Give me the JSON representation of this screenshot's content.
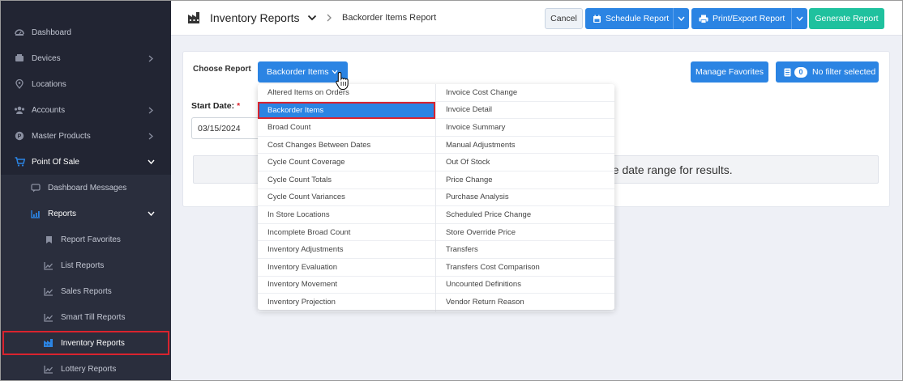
{
  "sidebar": {
    "items": [
      {
        "label": "Dashboard",
        "icon": "dashboard-icon"
      },
      {
        "label": "Devices",
        "icon": "devices-icon"
      },
      {
        "label": "Locations",
        "icon": "location-pin-icon"
      },
      {
        "label": "Accounts",
        "icon": "users-icon"
      },
      {
        "label": "Master Products",
        "icon": "product-icon"
      },
      {
        "label": "Point Of Sale",
        "icon": "cart-icon"
      },
      {
        "label": "Dashboard Messages",
        "icon": "message-icon"
      },
      {
        "label": "Reports",
        "icon": "chart-icon"
      },
      {
        "label": "Report Favorites",
        "icon": "bookmark-icon"
      },
      {
        "label": "List Reports",
        "icon": "chart-icon"
      },
      {
        "label": "Sales Reports",
        "icon": "chart-icon"
      },
      {
        "label": "Smart Till Reports",
        "icon": "chart-icon"
      },
      {
        "label": "Inventory Reports",
        "icon": "factory-icon"
      },
      {
        "label": "Lottery Reports",
        "icon": "chart-icon"
      }
    ]
  },
  "header": {
    "title": "Inventory Reports",
    "breadcrumb": "Backorder Items Report",
    "cancel_label": "Cancel",
    "schedule_label": "Schedule Report",
    "print_label": "Print/Export Report",
    "generate_label": "Generate Report"
  },
  "report": {
    "choose_label": "Choose Report",
    "selected": "Backorder Items",
    "manage_favorites_label": "Manage Favorites",
    "filter_count": "0",
    "filter_label": "No filter selected",
    "start_date_label": "Start Date:",
    "required_mark": "*",
    "start_date_value": "03/15/2024",
    "info_text": "he date range for results."
  },
  "menu": {
    "left": [
      "Altered Items on Orders",
      "Backorder Items",
      "Broad Count",
      "Cost Changes Between Dates",
      "Cycle Count Coverage",
      "Cycle Count Totals",
      "Cycle Count Variances",
      "In Store Locations",
      "Incomplete Broad Count",
      "Inventory Adjustments",
      "Inventory Evaluation",
      "Inventory Movement",
      "Inventory Projection"
    ],
    "right": [
      "Invoice Cost Change",
      "Invoice Detail",
      "Invoice Summary",
      "Manual Adjustments",
      "Out Of Stock",
      "Price Change",
      "Purchase Analysis",
      "Scheduled Price Change",
      "Store Override Price",
      "Transfers",
      "Transfers Cost Comparison",
      "Uncounted Definitions",
      "Vendor Return Reason"
    ]
  },
  "colors": {
    "sidebar_bg": "#222533",
    "primary": "#2b84e3",
    "success": "#1fc19e",
    "highlight_red": "#d9232e"
  }
}
